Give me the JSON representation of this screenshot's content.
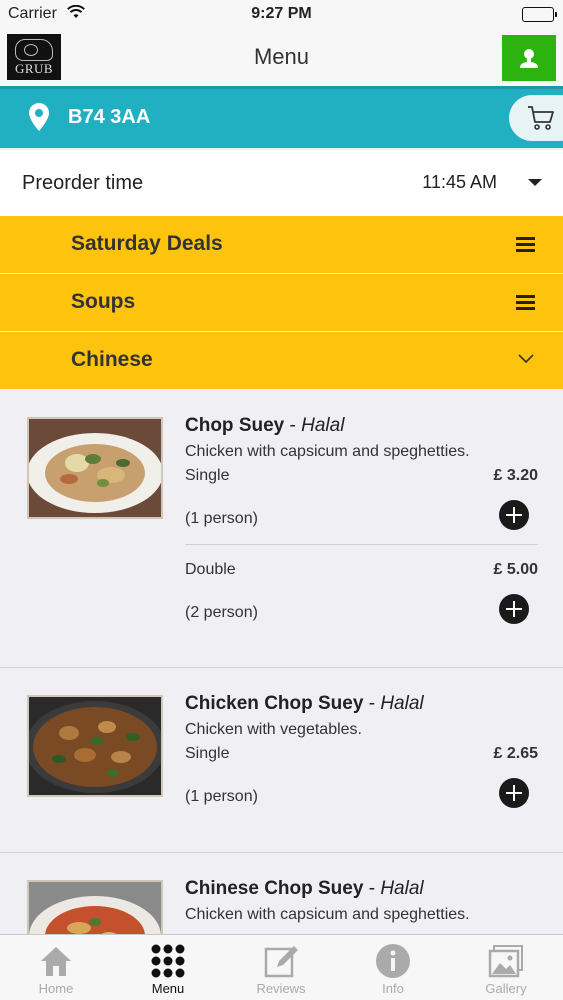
{
  "status_bar": {
    "carrier": "Carrier",
    "time": "9:27 PM"
  },
  "header": {
    "logo_text": "GRUB",
    "title": "Menu"
  },
  "location": {
    "postcode": "B74 3AA"
  },
  "preorder": {
    "label": "Preorder time",
    "value": "11:45 AM"
  },
  "categories": [
    {
      "label": "Saturday Deals",
      "icon": "hamburger-icon"
    },
    {
      "label": "Soups",
      "icon": "hamburger-icon"
    },
    {
      "label": "Chinese",
      "icon": "chevron-down-icon"
    }
  ],
  "menu_items": [
    {
      "name": "Chop Suey",
      "tag": "Halal",
      "description": "Chicken with capsicum and speghetties.",
      "variants": [
        {
          "name": "Single",
          "price": "£ 3.20",
          "qty": "(1 person)"
        },
        {
          "name": "Double",
          "price": "£ 5.00",
          "qty": "(2 person)"
        }
      ]
    },
    {
      "name": "Chicken Chop Suey",
      "tag": "Halal",
      "description": "Chicken with vegetables.",
      "variants": [
        {
          "name": "Single",
          "price": "£ 2.65",
          "qty": "(1 person)"
        }
      ]
    },
    {
      "name": "Chinese Chop Suey",
      "tag": "Halal",
      "description": "Chicken with capsicum and speghetties.",
      "variants": []
    }
  ],
  "tab_bar": {
    "tabs": [
      {
        "label": "Home",
        "icon": "home-icon"
      },
      {
        "label": "Menu",
        "icon": "grid-dots-icon",
        "active": true
      },
      {
        "label": "Reviews",
        "icon": "edit-icon"
      },
      {
        "label": "Info",
        "icon": "info-icon"
      },
      {
        "label": "Gallery",
        "icon": "gallery-icon"
      }
    ]
  },
  "colors": {
    "brand_teal": "#21b0c1",
    "category_yellow": "#fec30d",
    "profile_green": "#2db30f"
  }
}
